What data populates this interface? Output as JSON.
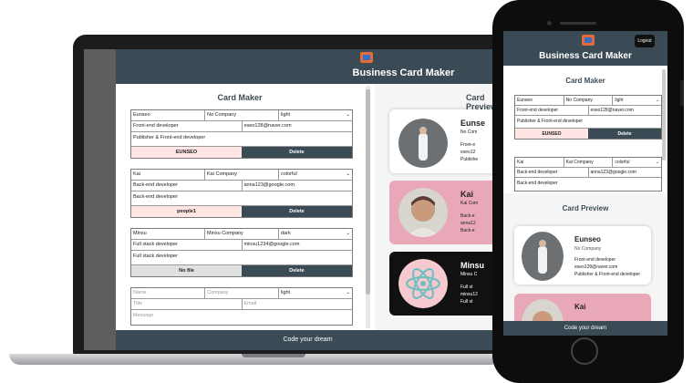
{
  "app": {
    "title": "Business Card Maker",
    "footer": "Code your dream",
    "maker_title": "Card Maker",
    "preview_title": "Card Preview"
  },
  "forms": [
    {
      "name": "Eunseo",
      "company": "No Company",
      "theme": "light",
      "title": "Front-end developer",
      "email": "eseo128@naver.com",
      "message": "Publisher & Front-end developer",
      "file": "EUNSEO",
      "delete": "Delete"
    },
    {
      "name": "Kai",
      "company": "Kai Company",
      "theme": "colorful",
      "title": "Back-end developer",
      "email": "anna123@google.com",
      "message": "Back-end developer",
      "file": "people1",
      "delete": "Delete"
    },
    {
      "name": "Minsu",
      "company": "Minsu Company",
      "theme": "dark",
      "title": "Full stack developer",
      "email": "minsu1234@google.com",
      "message": "Full stack developer",
      "file": "No file",
      "delete": "Delete"
    }
  ],
  "empty_form": {
    "name": "Name",
    "company": "Company",
    "theme": "light",
    "title": "Title",
    "email": "Email",
    "message": "Message"
  },
  "preview_cards": [
    {
      "name": "Eunse",
      "company": "No Com",
      "title": "Front-e",
      "email": "eseo12",
      "message": "Publishe"
    },
    {
      "name": "Kai",
      "company": "Kai Com",
      "title": "Back-e",
      "email": "anna12",
      "message": "Back-e"
    },
    {
      "name": "Minsu",
      "company": "Minsu C",
      "title": "Full st",
      "email": "minsu12",
      "message": "Full st"
    }
  ],
  "mobile": {
    "logout": "Logout",
    "title": "Business Card Maker",
    "maker_title": "Card Maker",
    "preview_title": "Card Preview",
    "footer": "Code your dream",
    "forms": [
      {
        "name": "Eunseo",
        "company": "No Company",
        "theme": "light",
        "title": "Front-end developer",
        "email": "eseo128@naver.com",
        "message": "Publisher & Front-end developer",
        "file": "EUNSEO",
        "delete": "Delete"
      },
      {
        "name": "Kai",
        "company": "Kai Company",
        "theme": "colorful",
        "title": "Back-end developer",
        "email": "anna123@google.com",
        "message": "Back-end developer"
      }
    ],
    "cards": [
      {
        "name": "Eunseo",
        "company": "No Company",
        "title": "Front-end developer",
        "email": "eseo128@naver.com",
        "message": "Publisher & Front-end developer"
      },
      {
        "name": "Kai"
      }
    ]
  },
  "colors": {
    "header": "#3b4b56",
    "file_button": "#ffe5e3",
    "colorful_card": "#e8a8b8",
    "dark_card": "#111111"
  }
}
